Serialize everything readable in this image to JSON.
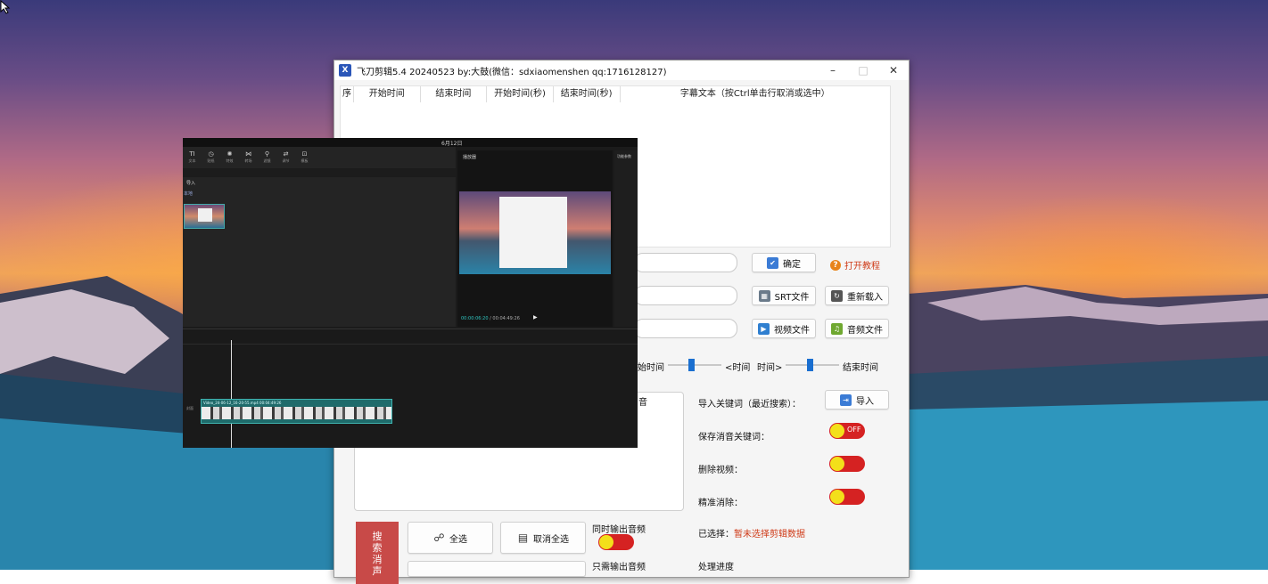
{
  "window": {
    "title": "飞刀剪辑5.4 20240523 by:大鼓(微信：sdxiaomenshen  qq:1716128127)",
    "icon_glyph": "X"
  },
  "subtitle_table": {
    "columns": [
      "序",
      "开始时间",
      "结束时间",
      "开始时间(秒)",
      "结束时间(秒)",
      "字幕文本（按Ctrl单击行取消或选中）"
    ]
  },
  "buttons": {
    "confirm": "确定",
    "open_tutorial": "打开教程",
    "srt_file": "SRT文件",
    "reload": "重新载入",
    "video_file": "视频文件",
    "audio_file": "音频文件",
    "import": "导入",
    "select_all": "全选",
    "deselect_all": "取消全选",
    "search_mute": "搜索消声"
  },
  "time_controls": {
    "start_time_label": "始时间",
    "lt_time": "<时间",
    "time_gt": "时间>",
    "end_time_label": "结束时间"
  },
  "keyword_area": {
    "partial_label": "音"
  },
  "options": {
    "import_keywords": "导入关键词（最近搜索）：",
    "save_mute_keywords": "保存消音关键词：",
    "delete_video": "删除视频：",
    "precise_remove": "精准消除：",
    "toggle_off_text": "OFF",
    "selected_label": "已选择：",
    "selected_value": "暂未选择剪辑数据",
    "output_audio_simul": "同时输出音频",
    "output_audio_only": "只需输出音频",
    "progress_label": "处理进度"
  },
  "colors": {
    "accent_blue": "#1a6fd0",
    "toggle_off": "#d52222",
    "toggle_knob": "#f3e01a",
    "warning_red": "#cf3a17",
    "search_button": "#c84a48"
  },
  "icons": {
    "confirm": "confirm-icon",
    "tutorial": "question-icon",
    "srt": "srt-icon",
    "reload": "reload-icon",
    "video": "video-icon",
    "audio": "audio-icon",
    "import": "import-icon",
    "select_all": "link-icon",
    "deselect_all": "document-icon"
  },
  "editor_overlay": {
    "title": "6月12日",
    "tools": [
      "TI",
      "◷",
      "✺",
      "⋈",
      "⚲",
      "⇄",
      "⊡"
    ],
    "tool_labels": [
      "文本",
      "贴纸",
      "特效",
      "转场",
      "滤镜",
      "调节",
      "模板"
    ],
    "import_label": "导入",
    "local_label": "本地",
    "preview_label": "播放器",
    "props_label": "功能参数",
    "time_current": "00:00:06:20",
    "time_total": "00:04:49:26",
    "clip_label": "Video_24-06-12_16-20-55.mp4   00:04:49:26",
    "track_label": "封面"
  }
}
